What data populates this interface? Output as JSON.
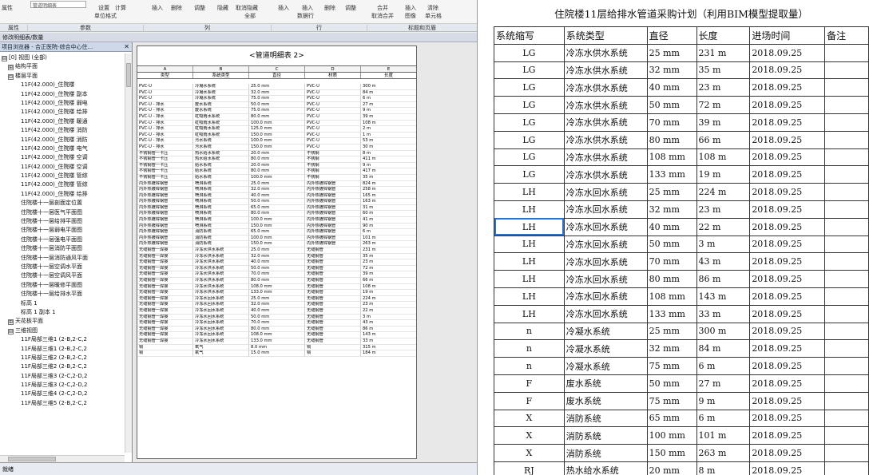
{
  "ribbon": {
    "select_value": "管道明细表",
    "labels": [
      "属性",
      "设置",
      "计算",
      "插入",
      "删除",
      "调整",
      "隐藏",
      "取消隐藏",
      "插入",
      "插入",
      "删除",
      "调整",
      "合并",
      "插入",
      "清除"
    ],
    "labels2": [
      "单位格式",
      "全部",
      "数据行",
      "取消合并",
      "图像",
      "单元格"
    ],
    "groups": [
      "属性",
      "参数",
      "列",
      "行",
      "标题和页眉"
    ]
  },
  "context_bar": "修改明细表/数量",
  "browser": {
    "title": "项目浏览器 - 合正医院-综合中心住...",
    "close": "✕",
    "tree": [
      {
        "indent": 0,
        "toggle": "⊟",
        "text": "[0] 视图 (全部)"
      },
      {
        "indent": 1,
        "toggle": "⊞",
        "text": "结构平面"
      },
      {
        "indent": 1,
        "toggle": "⊟",
        "text": "楼层平面"
      },
      {
        "indent": 3,
        "toggle": "",
        "text": "11F(42.000)_住院楼"
      },
      {
        "indent": 3,
        "toggle": "",
        "text": "11F(42.000)_住院楼 副本"
      },
      {
        "indent": 3,
        "toggle": "",
        "text": "11F(42.000)_住院楼 弱电"
      },
      {
        "indent": 3,
        "toggle": "",
        "text": "11F(42.000)_住院楼 给排"
      },
      {
        "indent": 3,
        "toggle": "",
        "text": "11F(42.000)_住院楼 暖通"
      },
      {
        "indent": 3,
        "toggle": "",
        "text": "11F(42.000)_住院楼 消防"
      },
      {
        "indent": 3,
        "toggle": "",
        "text": "11F(42.000)_住院楼 消防"
      },
      {
        "indent": 3,
        "toggle": "",
        "text": "11F(42.000)_住院楼 电气"
      },
      {
        "indent": 3,
        "toggle": "",
        "text": "11F(42.000)_住院楼 空调"
      },
      {
        "indent": 3,
        "toggle": "",
        "text": "11F(42.000)_住院楼 空调"
      },
      {
        "indent": 3,
        "toggle": "",
        "text": "11F(42.000)_住院楼 管综"
      },
      {
        "indent": 3,
        "toggle": "",
        "text": "11F(42.000)_住院楼 管综"
      },
      {
        "indent": 3,
        "toggle": "",
        "text": "11F(42.000)_住院楼 给排"
      },
      {
        "indent": 3,
        "toggle": "",
        "text": "住院楼十一层剖面定位置"
      },
      {
        "indent": 3,
        "toggle": "",
        "text": "住院楼十一层医气平面图"
      },
      {
        "indent": 3,
        "toggle": "",
        "text": "住院楼十一层给排平面图"
      },
      {
        "indent": 3,
        "toggle": "",
        "text": "住院楼十一层弱电平面图"
      },
      {
        "indent": 3,
        "toggle": "",
        "text": "住院楼十一层强电平面图"
      },
      {
        "indent": 3,
        "toggle": "",
        "text": "住院楼十一层消防平面图"
      },
      {
        "indent": 3,
        "toggle": "",
        "text": "住院楼十一层消防通风平面"
      },
      {
        "indent": 3,
        "toggle": "",
        "text": "住院楼十一层空调水平面"
      },
      {
        "indent": 3,
        "toggle": "",
        "text": "住院楼十一层空调风平面"
      },
      {
        "indent": 3,
        "toggle": "",
        "text": "住院楼十一层暖修平面图"
      },
      {
        "indent": 3,
        "toggle": "",
        "text": "住院楼十一层给排水平面"
      },
      {
        "indent": 3,
        "toggle": "",
        "text": "标高 1"
      },
      {
        "indent": 3,
        "toggle": "",
        "text": "标高 1 副本 1"
      },
      {
        "indent": 1,
        "toggle": "⊞",
        "text": "天花板平面"
      },
      {
        "indent": 1,
        "toggle": "⊟",
        "text": "三维视图"
      },
      {
        "indent": 3,
        "toggle": "",
        "text": "11F局部三维1 (2-B,2-C,2"
      },
      {
        "indent": 3,
        "toggle": "",
        "text": "11F局部三维1 (2-B,2-C,2"
      },
      {
        "indent": 3,
        "toggle": "",
        "text": "11F局部三维2 (2-B,2-C,2"
      },
      {
        "indent": 3,
        "toggle": "",
        "text": "11F局部三维2 (2-B,2-C,2"
      },
      {
        "indent": 3,
        "toggle": "",
        "text": "11F局部三维3 (2-C,2-D,2"
      },
      {
        "indent": 3,
        "toggle": "",
        "text": "11F局部三维3 (2-C,2-D,2"
      },
      {
        "indent": 3,
        "toggle": "",
        "text": "11F局部三维4 (2-C,2-D,2"
      },
      {
        "indent": 3,
        "toggle": "",
        "text": "11F局部三维5 (2-B,2-C,2"
      }
    ]
  },
  "schedule": {
    "title": "<管道明细表 2>",
    "letters": [
      "A",
      "B",
      "C",
      "D",
      "E"
    ],
    "headers": [
      "类型",
      "系统类型",
      "直径",
      "材质",
      "长度"
    ],
    "rows": [
      [
        "PVC-U",
        "冷凝水系统",
        "25.0 mm",
        "PVC-U",
        "300 m"
      ],
      [
        "PVC-U",
        "冷凝水系统",
        "32.0 mm",
        "PVC-U",
        "84 m"
      ],
      [
        "PVC-U",
        "冷凝水系统",
        "75.0 mm",
        "PVC-U",
        "6 m"
      ],
      [
        "PVC-U - 排水",
        "废水系统",
        "50.0 mm",
        "PVC-U",
        "27 m"
      ],
      [
        "PVC-U - 排水",
        "废水系统",
        "75.0 mm",
        "PVC-U",
        "9 m"
      ],
      [
        "PVC-U - 排水",
        "虹吸雨水系统",
        "80.0 mm",
        "PVC-U",
        "39 m"
      ],
      [
        "PVC-U - 排水",
        "虹吸雨水系统",
        "100.0 mm",
        "PVC-U",
        "108 m"
      ],
      [
        "PVC-U - 排水",
        "虹吸雨水系统",
        "125.0 mm",
        "PVC-U",
        "2 m"
      ],
      [
        "PVC-U - 排水",
        "虹吸雨水系统",
        "150.0 mm",
        "PVC-U",
        "1 m"
      ],
      [
        "PVC-U - 排水",
        "污水系统",
        "100.0 mm",
        "PVC-U",
        "53 m"
      ],
      [
        "PVC-U - 排水",
        "污水系统",
        "150.0 mm",
        "PVC-U",
        "30 m"
      ],
      [
        "不锈钢管一卡压",
        "热水给水系统",
        "20.0 mm",
        "不锈钢",
        "8 m"
      ],
      [
        "不锈钢管一卡压",
        "热水给水系统",
        "80.0 mm",
        "不锈钢",
        "411 m"
      ],
      [
        "不锈钢管一卡压",
        "给水系统",
        "20.0 mm",
        "不锈钢",
        "9 m"
      ],
      [
        "不锈钢管一卡压",
        "给水系统",
        "80.0 mm",
        "不锈钢",
        "417 m"
      ],
      [
        "不锈钢管一卡压",
        "给水系统",
        "100.0 mm",
        "不锈钢",
        "35 m"
      ],
      [
        "内外热镀锌钢管",
        "喷淋系统",
        "25.0 mm",
        "内外热镀锌钢管",
        "824 m"
      ],
      [
        "内外热镀锌钢管",
        "喷淋系统",
        "32.0 mm",
        "内外热镀锌钢管",
        "258 m"
      ],
      [
        "内外热镀锌钢管",
        "喷淋系统",
        "40.0 mm",
        "内外热镀锌钢管",
        "165 m"
      ],
      [
        "内外热镀锌钢管",
        "喷淋系统",
        "50.0 mm",
        "内外热镀锌钢管",
        "163 m"
      ],
      [
        "内外热镀锌钢管",
        "喷淋系统",
        "65.0 mm",
        "内外热镀锌钢管",
        "31 m"
      ],
      [
        "内外热镀锌钢管",
        "喷淋系统",
        "80.0 mm",
        "内外热镀锌钢管",
        "60 m"
      ],
      [
        "内外热镀锌钢管",
        "喷淋系统",
        "100.0 mm",
        "内外热镀锌钢管",
        "41 m"
      ],
      [
        "内外热镀锌钢管",
        "喷淋系统",
        "150.0 mm",
        "内外热镀锌钢管",
        "90 m"
      ],
      [
        "内外热镀锌钢管",
        "消防系统",
        "65.0 mm",
        "内外热镀锌钢管",
        "6 m"
      ],
      [
        "内外热镀锌钢管",
        "消防系统",
        "100.0 mm",
        "内外热镀锌钢管",
        "101 m"
      ],
      [
        "内外热镀锌钢管",
        "消防系统",
        "150.0 mm",
        "内外热镀锌钢管",
        "263 m"
      ],
      [
        "无缝钢管一焊接",
        "冷冻水供水系统",
        "25.0 mm",
        "无缝钢管",
        "231 m"
      ],
      [
        "无缝钢管一焊接",
        "冷冻水供水系统",
        "32.0 mm",
        "无缝钢管",
        "35 m"
      ],
      [
        "无缝钢管一焊接",
        "冷冻水供水系统",
        "40.0 mm",
        "无缝钢管",
        "23 m"
      ],
      [
        "无缝钢管一焊接",
        "冷冻水供水系统",
        "50.0 mm",
        "无缝钢管",
        "72 m"
      ],
      [
        "无缝钢管一焊接",
        "冷冻水供水系统",
        "70.0 mm",
        "无缝钢管",
        "39 m"
      ],
      [
        "无缝钢管一焊接",
        "冷冻水供水系统",
        "80.0 mm",
        "无缝钢管",
        "66 m"
      ],
      [
        "无缝钢管一焊接",
        "冷冻水供水系统",
        "108.0 mm",
        "无缝钢管",
        "108 m"
      ],
      [
        "无缝钢管一焊接",
        "冷冻水供水系统",
        "133.0 mm",
        "无缝钢管",
        "19 m"
      ],
      [
        "无缝钢管一焊接",
        "冷冻水回水系统",
        "25.0 mm",
        "无缝钢管",
        "224 m"
      ],
      [
        "无缝钢管一焊接",
        "冷冻水回水系统",
        "32.0 mm",
        "无缝钢管",
        "23 m"
      ],
      [
        "无缝钢管一焊接",
        "冷冻水回水系统",
        "40.0 mm",
        "无缝钢管",
        "22 m"
      ],
      [
        "无缝钢管一焊接",
        "冷冻水回水系统",
        "50.0 mm",
        "无缝钢管",
        "3 m"
      ],
      [
        "无缝钢管一焊接",
        "冷冻水回水系统",
        "70.0 mm",
        "无缝钢管",
        "43 m"
      ],
      [
        "无缝钢管一焊接",
        "冷冻水回水系统",
        "80.0 mm",
        "无缝钢管",
        "86 m"
      ],
      [
        "无缝钢管一焊接",
        "冷冻水回水系统",
        "108.0 mm",
        "无缝钢管",
        "143 m"
      ],
      [
        "无缝钢管一焊接",
        "冷冻水回水系统",
        "133.0 mm",
        "无缝钢管",
        "33 m"
      ],
      [
        "铜",
        "氧气",
        "8.0 mm",
        "铜",
        "315 m"
      ],
      [
        "铜",
        "氧气",
        "15.0 mm",
        "铜",
        "184 m"
      ]
    ]
  },
  "status_text": "就绪",
  "plan": {
    "title": "住院楼11层给排水管道采购计划（利用BIM模型提取量）",
    "headers": [
      "系统缩写",
      "系统类型",
      "直径",
      "长度",
      "进场时间",
      "备注"
    ],
    "rows": [
      [
        "LG",
        "冷冻水供水系统",
        "25 mm",
        "231 m",
        "2018.09.25",
        ""
      ],
      [
        "LG",
        "冷冻水供水系统",
        "32 mm",
        "35 m",
        "2018.09.25",
        ""
      ],
      [
        "LG",
        "冷冻水供水系统",
        "40 mm",
        "23 m",
        "2018.09.25",
        ""
      ],
      [
        "LG",
        "冷冻水供水系统",
        "50 mm",
        "72 m",
        "2018.09.25",
        ""
      ],
      [
        "LG",
        "冷冻水供水系统",
        "70 mm",
        "39 m",
        "2018.09.25",
        ""
      ],
      [
        "LG",
        "冷冻水供水系统",
        "80 mm",
        "66 m",
        "2018.09.25",
        ""
      ],
      [
        "LG",
        "冷冻水供水系统",
        "108 mm",
        "108 m",
        "2018.09.25",
        ""
      ],
      [
        "LG",
        "冷冻水供水系统",
        "133 mm",
        "19 m",
        "2018.09.25",
        ""
      ],
      [
        "LH",
        "冷冻水回水系统",
        "25 mm",
        "224 m",
        "2018.09.25",
        ""
      ],
      [
        "LH",
        "冷冻水回水系统",
        "32 mm",
        "23 m",
        "2018.09.25",
        ""
      ],
      [
        "LH",
        "冷冻水回水系统",
        "40 mm",
        "22 m",
        "2018.09.25",
        ""
      ],
      [
        "LH",
        "冷冻水回水系统",
        "50 mm",
        "3 m",
        "2018.09.25",
        ""
      ],
      [
        "LH",
        "冷冻水回水系统",
        "70 mm",
        "43 m",
        "2018.09.25",
        ""
      ],
      [
        "LH",
        "冷冻水回水系统",
        "80 mm",
        "86 m",
        "2018.09.25",
        ""
      ],
      [
        "LH",
        "冷冻水回水系统",
        "108 mm",
        "143 m",
        "2018.09.25",
        ""
      ],
      [
        "LH",
        "冷冻水回水系统",
        "133 mm",
        "33 m",
        "2018.09.25",
        ""
      ],
      [
        "n",
        "冷凝水系统",
        "25 mm",
        "300 m",
        "2018.09.25",
        ""
      ],
      [
        "n",
        "冷凝水系统",
        "32 mm",
        "84 m",
        "2018.09.25",
        ""
      ],
      [
        "n",
        "冷凝水系统",
        "75 mm",
        "6 m",
        "2018.09.25",
        ""
      ],
      [
        "F",
        "废水系统",
        "50 mm",
        "27 m",
        "2018.09.25",
        ""
      ],
      [
        "F",
        "废水系统",
        "75 mm",
        "9 m",
        "2018.09.25",
        ""
      ],
      [
        "X",
        "消防系统",
        "65 mm",
        "6 m",
        "2018.09.25",
        ""
      ],
      [
        "X",
        "消防系统",
        "100 mm",
        "101 m",
        "2018.09.25",
        ""
      ],
      [
        "X",
        "消防系统",
        "150 mm",
        "263 m",
        "2018.09.25",
        ""
      ],
      [
        "RJ",
        "热水给水系统",
        "20 mm",
        "8 m",
        "2018.09.25",
        ""
      ]
    ]
  }
}
